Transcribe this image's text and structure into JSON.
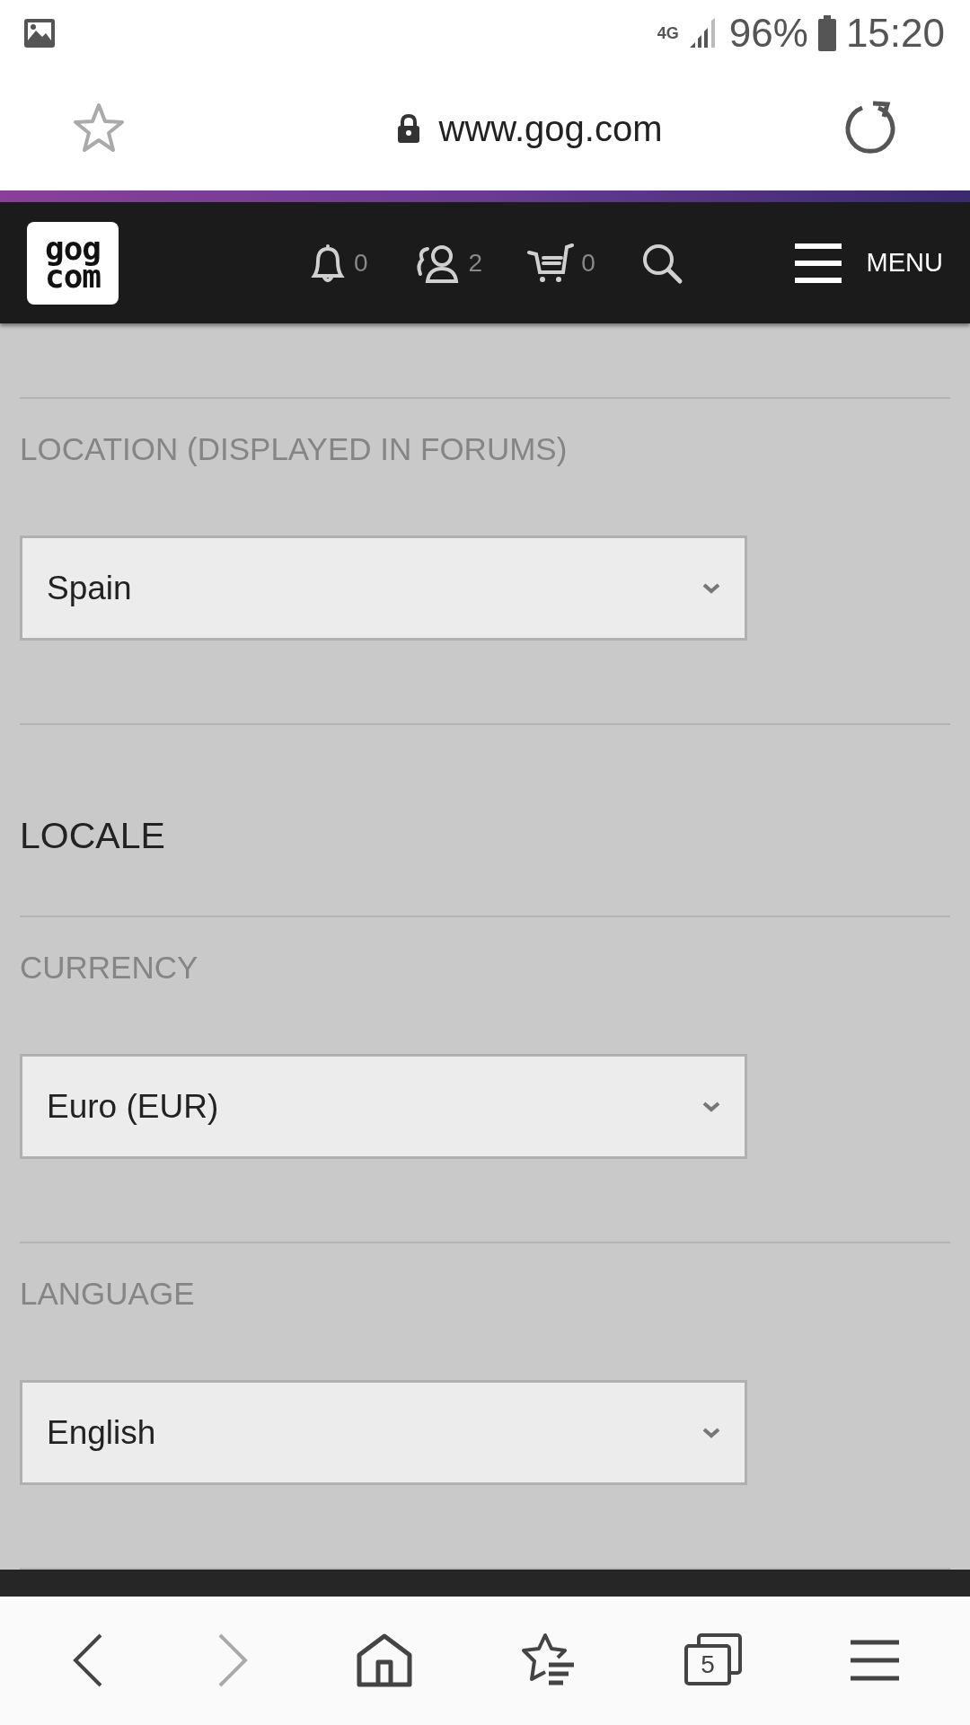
{
  "status_bar": {
    "network": "4G",
    "battery": "96%",
    "time": "15:20"
  },
  "browser": {
    "url": "www.gog.com"
  },
  "site_nav": {
    "logo": [
      "gog",
      "com"
    ],
    "icons": [
      {
        "kind": "bell",
        "count": "0"
      },
      {
        "kind": "friends",
        "count": "2"
      },
      {
        "kind": "cart",
        "count": "0"
      },
      {
        "kind": "search"
      }
    ],
    "menu_label": "MENU"
  },
  "sections": [
    {
      "kind": "field",
      "label": "LOCATION (DISPLAYED IN FORUMS)",
      "value": "Spain"
    },
    {
      "kind": "heading",
      "label": "LOCALE"
    },
    {
      "kind": "field",
      "label": "CURRENCY",
      "value": "Euro (EUR)"
    },
    {
      "kind": "field",
      "label": "LANGUAGE",
      "value": "English"
    }
  ],
  "bottom_bar": {
    "forward_disabled": true,
    "tabs_count": "5"
  }
}
